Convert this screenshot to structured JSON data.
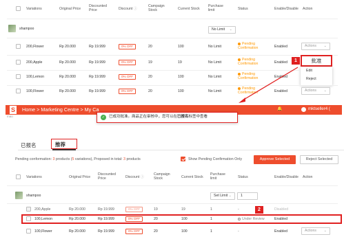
{
  "top": {
    "headers": {
      "variations": "Variations",
      "original_price": "Original Price",
      "discounted_price": "Discounted Price",
      "discount": "Discount",
      "campaign_stock": "Campaign Stock",
      "current_stock": "Current Stock",
      "purchase_limit": "Purchase limit",
      "status": "Status",
      "enable_disable": "Enable/Disable",
      "action": "Action"
    },
    "product_name": "shampoo",
    "product_limit": "No Limit",
    "rows": [
      {
        "name": "200,Flower",
        "original": "Rp 20.000",
        "discounted": "Rp 19.999",
        "off": "0% OFF",
        "campaign": "20",
        "current": "100",
        "limit": "No Limit",
        "status": "Pending Confirmation",
        "enabled": "Enabled",
        "action": "Actions"
      },
      {
        "name": "200,Apple",
        "original": "Rp 20.000",
        "discounted": "Rp 19.999",
        "off": "0% OFF",
        "campaign": "19",
        "current": "19",
        "limit": "No Limit",
        "status": "Pending Confirmation",
        "enabled": "Enabled",
        "action": "批准"
      },
      {
        "name": "100,Lemon",
        "original": "Rp 20.000",
        "discounted": "Rp 19.999",
        "off": "0% OFF",
        "campaign": "20",
        "current": "100",
        "limit": "No Limit",
        "status": "Pending Confirmation",
        "enabled": "Enabled"
      },
      {
        "name": "100,Flower",
        "original": "Rp 20.000",
        "discounted": "Rp 19.999",
        "off": "0% OFF",
        "campaign": "20",
        "current": "100",
        "limit": "No Limit",
        "status": "Pending Confirmation",
        "enabled": "Enabled",
        "action": "Actions"
      }
    ],
    "menu": [
      "Edit",
      "Reject"
    ],
    "marker": "1"
  },
  "bottom": {
    "nav": {
      "logo": "S",
      "breadcrumb": "Home > Marketing Centre > My Ca",
      "bell": "🔔",
      "user": "mktseller4 (",
      "logo_fragment": "mao"
    },
    "toast": {
      "text_before": "已成功批准。商品正在审核中，您可以在",
      "text_bold": "已报名",
      "text_after": "标签中查看"
    },
    "colors": {
      "shopee_orange": "#ee4d2d",
      "annotation_red": "#e02020",
      "pending": "#ff9800"
    },
    "tabs": {
      "registered": "已报名",
      "recommended": "推荐"
    },
    "summary": {
      "prefix": "Pending conformation",
      "count": "3",
      "mid": "products (",
      "variations": "5",
      "mid2": "variations), Proposed in total",
      "total": "3",
      "suffix": "products"
    },
    "show_pending": "Show Pending Confirmation Only",
    "approve": "Approve Selected",
    "reject": "Reject Selected",
    "headers": {
      "variations": "Variations",
      "original_price": "Original Price",
      "discounted_price": "Discounted Price",
      "discount": "Discount",
      "campaign_stock": "Campaign Stock",
      "current_stock": "Current Stock",
      "purchase_limit": "Purchase limit",
      "status": "Status",
      "enable_disable": "Enable/Disable",
      "action": "Action"
    },
    "product_name": "shampoo",
    "set_limit": "Set Limit",
    "set_limit_value": "1",
    "rows": [
      {
        "name": "200,Apple",
        "original": "Rp 20.000",
        "discounted": "Rp 19.999",
        "off": "0% OFF",
        "campaign": "19",
        "current": "19",
        "limit": "1",
        "status": "-",
        "enabled": "Disabled"
      },
      {
        "name": "100,Lemon",
        "original": "Rp 20.000",
        "discounted": "Rp 19.999",
        "off": "0% OFF",
        "campaign": "20",
        "current": "100",
        "limit": "1",
        "status": "Under Review",
        "enabled": "Enabled"
      },
      {
        "name": "100,Flower",
        "original": "Rp 20.000",
        "discounted": "Rp 19.999",
        "off": "0% OFF",
        "campaign": "20",
        "current": "100",
        "limit": "1",
        "status": "-",
        "enabled": "Enabled",
        "action": "Actions"
      }
    ],
    "marker": "2"
  }
}
